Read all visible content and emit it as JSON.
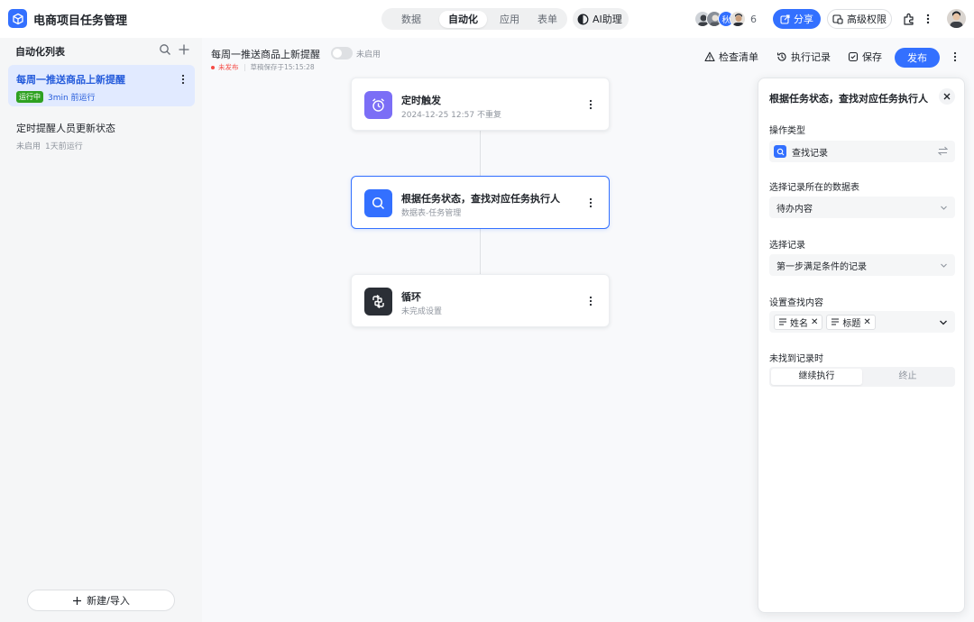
{
  "app": {
    "title": "电商项目任务管理"
  },
  "header": {
    "tabs": [
      {
        "label": "数据",
        "active": false
      },
      {
        "label": "自动化",
        "active": true
      },
      {
        "label": "应用",
        "active": false
      },
      {
        "label": "表单",
        "active": false
      }
    ],
    "ai_label": "AI助理",
    "avatar_badge": "秋",
    "collaborator_count": "6",
    "share_label": "分享",
    "permission_label": "高级权限"
  },
  "sidebar": {
    "title": "自动化列表",
    "items": [
      {
        "name": "每周一推送商品上新提醒",
        "status": "运行中",
        "last_run": "3min 前运行",
        "active": true
      },
      {
        "name": "定时提醒人员更新状态",
        "status": "未启用",
        "last_run": "1天前运行",
        "active": false
      }
    ],
    "new_button": "新建/导入"
  },
  "canvas": {
    "flow_title": "每周一推送商品上新提醒",
    "toggle_label": "未启用",
    "publish_status": "未发布",
    "draft_saved": "草稿保存于15:15:28",
    "toolbar": {
      "checklist": "检查清单",
      "history": "执行记录",
      "save": "保存",
      "publish": "发布"
    },
    "nodes": [
      {
        "title": "定时触发",
        "subtitle": "2024-12-25 12:57  不重复",
        "icon": "alarm-clock-icon",
        "color": "#7b6ef6"
      },
      {
        "title": "根据任务状态，查找对应任务执行人",
        "subtitle": "数据表-任务管理",
        "icon": "search-icon",
        "color": "#3370ff"
      },
      {
        "title": "循环",
        "subtitle": "未完成设置",
        "icon": "loop-icon",
        "color": "#2b2f36"
      }
    ]
  },
  "panel": {
    "title": "根据任务状态，查找对应任务执行人",
    "operation_label": "操作类型",
    "operation_value": "查找记录",
    "table_label": "选择记录所在的数据表",
    "table_value": "待办内容",
    "record_label": "选择记录",
    "record_value": "第一步满足条件的记录",
    "content_label": "设置查找内容",
    "content_chips": [
      "姓名",
      "标题"
    ],
    "not_found_label": "未找到记录时",
    "not_found_options": [
      "继续执行",
      "终止"
    ],
    "not_found_selected": "继续执行"
  }
}
